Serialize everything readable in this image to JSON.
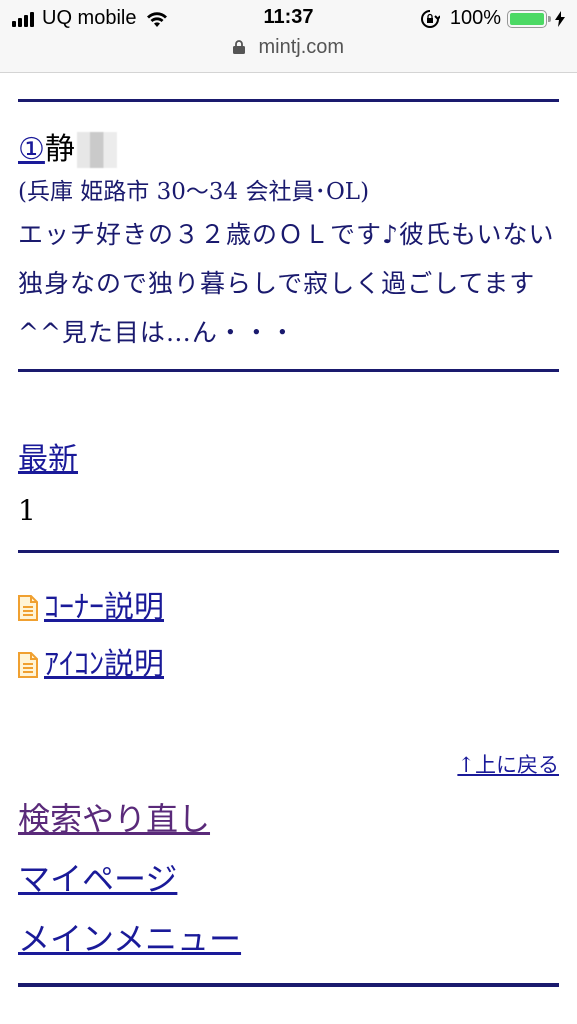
{
  "status_bar": {
    "carrier": "UQ mobile",
    "time": "11:37",
    "battery_percent": "100%",
    "battery_level": 1.0,
    "url": "mintj.com",
    "icons": [
      "signal-icon",
      "wifi-icon",
      "rotation-lock-icon",
      "battery-icon",
      "charging-icon",
      "padlock-icon"
    ]
  },
  "profile": {
    "number": "①",
    "name_visible": "静",
    "meta": "(兵庫 姫路市 30〜34 会社員･OL)",
    "description": "エッチ好きの３２歳のＯＬです♪彼氏もいない独身なので独り暮らしで寂しく過ごしてます^^見た目は…ん・・・"
  },
  "latest": {
    "label": "最新",
    "count": "1"
  },
  "icon_links": [
    {
      "label": "ｺｰﾅｰ説明",
      "icon": "document-icon"
    },
    {
      "label": "ｱｲｺﾝ説明",
      "icon": "document-icon"
    }
  ],
  "back_to_top": "↑上に戻る",
  "menu": [
    {
      "label": "検索やり直し",
      "visited": true
    },
    {
      "label": "マイページ",
      "visited": false
    },
    {
      "label": "メインメニュー",
      "visited": false
    }
  ],
  "colors": {
    "rule": "#1a1a6e",
    "link": "#1a1a99",
    "visited_link": "#5a2a7a",
    "text": "#1a1a6e",
    "battery": "#4cd964",
    "doc_icon": "#f0a030"
  }
}
